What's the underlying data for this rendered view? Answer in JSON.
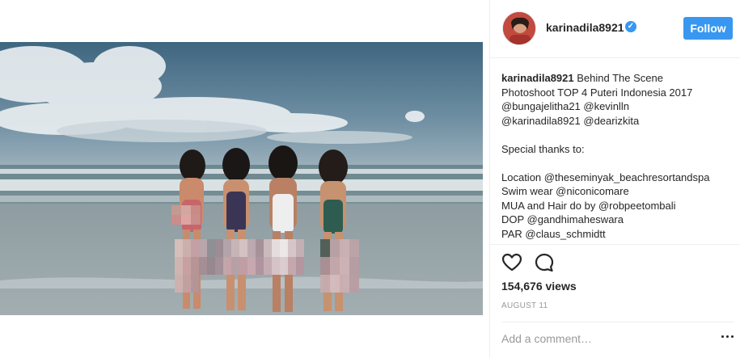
{
  "post": {
    "username": "karinadila8921",
    "verified_icon": "verified-badge-icon",
    "follow_label": "Follow",
    "caption_user": "karinadila8921",
    "caption_lines": [
      " Behind The Scene",
      "Photoshoot TOP 4 Puteri Indonesia 2017",
      "@bungajelitha21 @kevinlln",
      "@karinadila8921 @dearizkita",
      "",
      "Special thanks to:",
      "",
      "Location @theseminyak_beachresortandspa",
      "Swim wear @niconicomare",
      "MUA and Hair do by @robpeetombali",
      "DOP @gandhimaheswara",
      "PAR @claus_schmidtt"
    ],
    "views": "154,676 views",
    "date": "AUGUST 11",
    "comment_placeholder": "Add a comment…"
  },
  "icons": {
    "like": "heart-icon",
    "comment": "speech-bubble-icon",
    "more": "more-options-icon"
  },
  "colors": {
    "accent": "#3897f0",
    "text": "#262626",
    "muted": "#999999",
    "divider": "#efefef"
  }
}
